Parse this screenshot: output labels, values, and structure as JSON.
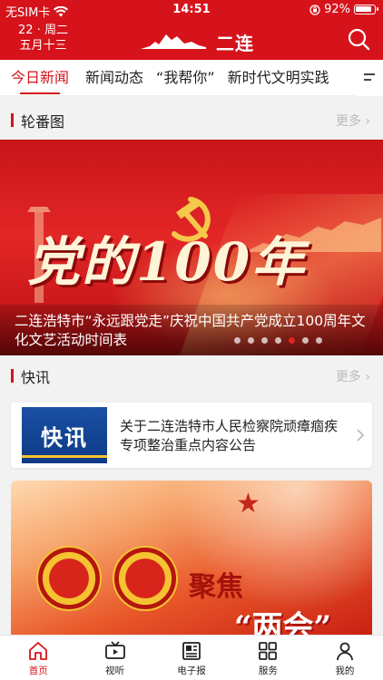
{
  "status_bar": {
    "carrier": "无SIM卡",
    "time": "14:51",
    "battery": "92%"
  },
  "header": {
    "date_line1": "22 · 周二",
    "date_line2": "五月十三",
    "logo_text": "二连"
  },
  "tabs": [
    "今日新闻",
    "新闻动态",
    "“我帮你”",
    "新时代文明实践"
  ],
  "carousel_section": {
    "title": "轮番图",
    "more": "更多"
  },
  "carousel": {
    "headline": "党的100年",
    "caption": "二连浩特市“永远跟党走”庆祝中国共产党成立100周年文化文艺活动时间表",
    "slide_count": 7,
    "active_index": 4
  },
  "flash_section": {
    "title": "快讯",
    "more": "更多"
  },
  "flash_item": {
    "image_label": "快讯",
    "text": "关于二连浩特市人民检察院顽瘴痼疾专项整治重点内容公告"
  },
  "feature": {
    "line1": "聚焦",
    "line2": "“两会”"
  },
  "bottom_nav": [
    {
      "label": "首页",
      "icon": "home-icon"
    },
    {
      "label": "视听",
      "icon": "video-icon"
    },
    {
      "label": "电子报",
      "icon": "newspaper-icon"
    },
    {
      "label": "服务",
      "icon": "grid-icon"
    },
    {
      "label": "我的",
      "icon": "user-icon"
    }
  ],
  "colors": {
    "brand_red": "#d6131b",
    "text": "#222222",
    "muted": "#bbbbbb"
  }
}
